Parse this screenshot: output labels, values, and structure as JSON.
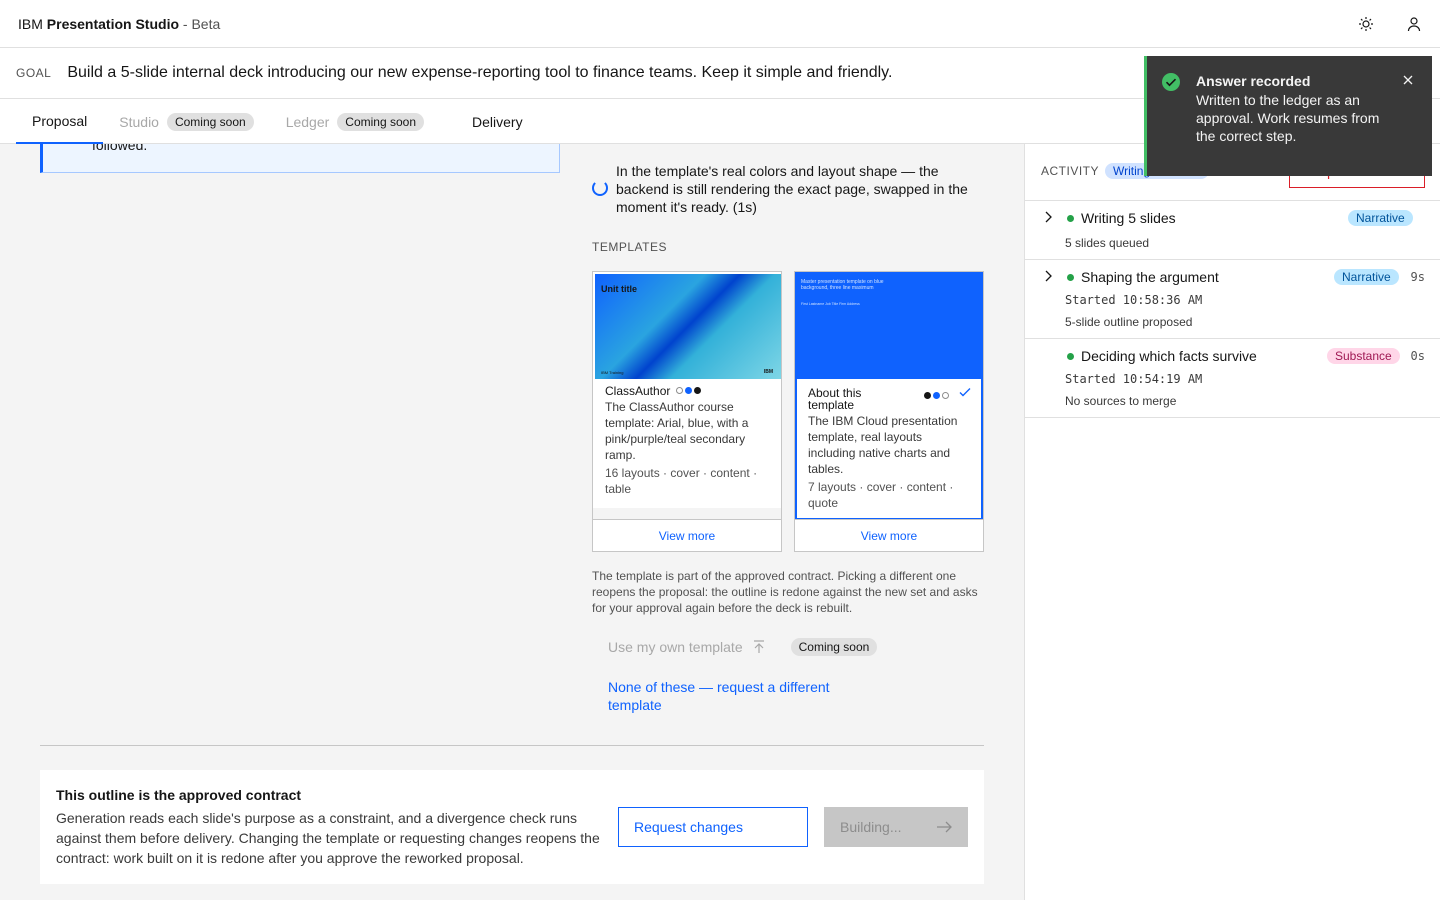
{
  "app": {
    "brand_prefix": "IBM",
    "brand_name": "Presentation Studio",
    "brand_suffix": "- Beta",
    "icons": [
      "sun-icon",
      "user-icon"
    ]
  },
  "goal": {
    "label": "GOAL",
    "text": "Build a 5-slide internal deck introducing our new expense-reporting tool to finance teams. Keep it simple and friendly."
  },
  "tabs": [
    {
      "label": "Proposal",
      "state": "active"
    },
    {
      "label": "Studio",
      "badge": "Coming soon",
      "state": "disabled"
    },
    {
      "label": "Ledger",
      "badge": "Coming soon",
      "state": "disabled"
    },
    {
      "label": "Delivery",
      "state": "enabled"
    }
  ],
  "proposal": {
    "callout_text": "followed.",
    "loading_text": "In the template's real colors and layout shape — the backend is still rendering the exact page, swapped in the moment it's ready. (1s)",
    "templates_label": "TEMPLATES",
    "templates": [
      {
        "thumb_title": "Unit title",
        "thumb_footer": "IBM Training",
        "thumb_logo": "IBM",
        "name": "ClassAuthor",
        "description": "The ClassAuthor course template: Arial, blue, with a pink/purple/teal secondary ramp.",
        "meta": "16 layouts · cover · content · table",
        "view_more": "View more",
        "selected": false
      },
      {
        "thumb_title": "Master presentation template on blue background, three line maximum",
        "thumb_sub": "First Lastname Job Title Firm Address",
        "name": "About this template",
        "description": "The IBM Cloud presentation template, real layouts including native charts and tables.",
        "meta": "7 layouts · cover · content · quote",
        "view_more": "View more",
        "selected": true
      }
    ],
    "note": "The template is part of the approved contract. Picking a different one reopens the proposal: the outline is redone against the new set and asks for your approval again before the deck is rebuilt.",
    "own_template_label": "Use my own template",
    "own_template_badge": "Coming soon",
    "different_template_link": "None of these — request a different template"
  },
  "contract": {
    "title": "This outline is the approved contract",
    "text": "Generation reads each slide's purpose as a constraint, and a divergence check runs against them before delivery. Changing the template or requesting changes reopens the contract: work built on it is redone after you approve the reworked proposal.",
    "request_changes_label": "Request changes",
    "building_label": "Building..."
  },
  "activity": {
    "label": "ACTIVITY",
    "status_pill": "Writing",
    "stop_label": "Stop run",
    "items": [
      {
        "title": "Writing 5 slides",
        "tag": "Narrative",
        "duration": "",
        "started": "",
        "note": "5 slides queued",
        "status_color": "#24a148"
      },
      {
        "title": "Shaping the argument",
        "tag": "Narrative",
        "duration": "9s",
        "started": "Started 10:58:36 AM",
        "note": "5-slide outline proposed",
        "status_color": "#24a148"
      },
      {
        "title": "Deciding which facts survive",
        "tag": "Substance",
        "duration": "0s",
        "started": "Started 10:54:19 AM",
        "note": "No sources to merge",
        "status_color": "#24a148"
      }
    ]
  },
  "toast": {
    "title": "Answer recorded",
    "text": "Written to the ledger as an approval. Work resumes from the correct step.",
    "accent": "#42be65"
  },
  "colors": {
    "primary": "#0f62fe",
    "success": "#24a148",
    "danger": "#da1e28"
  }
}
